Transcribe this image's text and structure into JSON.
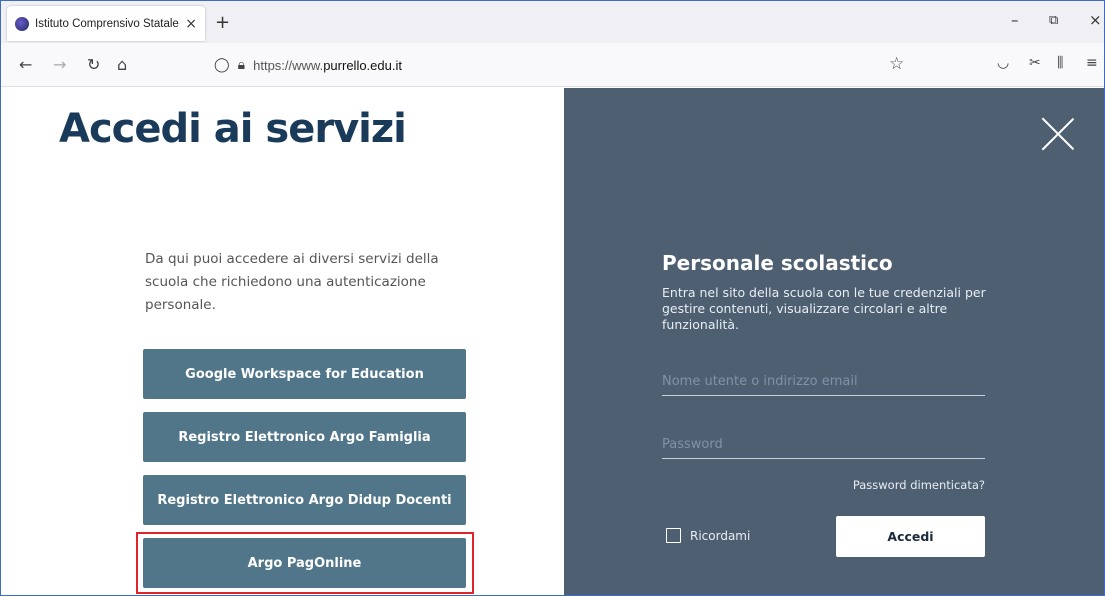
{
  "browser": {
    "tab_title": "Istituto Comprensivo Statale \"M",
    "tab_title_fade": "…",
    "tab_close": "×",
    "new_tab": "+",
    "url_prefix": "https://www.",
    "url_domain": "purrello.edu.it",
    "window_controls": [
      "–",
      "⧉",
      "×"
    ]
  },
  "page": {
    "title": "Accedi ai servizi",
    "intro": "Da qui puoi accedere ai diversi servizi della scuola che richiedono una autenticazione personale.",
    "services": [
      "Google Workspace for Education",
      "Registro Elettronico Argo Famiglia",
      "Registro Elettronico Argo Didup Docenti",
      "Argo PagOnline"
    ],
    "highlighted_service_index": 3
  },
  "login_panel": {
    "title": "Personale scolastico",
    "description": "Entra nel sito della scuola con le tue credenziali per gestire contenuti, visualizzare circolari e altre funzionalità.",
    "username_placeholder": "Nome utente o indirizzo email",
    "password_placeholder": "Password",
    "forgot_password": "Password dimenticata?",
    "remember_me": "Ricordami",
    "submit": "Accedi"
  },
  "colors": {
    "title": "#1a3a5a",
    "service_button": "#517689",
    "panel_bg": "#4e5f72",
    "highlight": "#e0242a"
  }
}
